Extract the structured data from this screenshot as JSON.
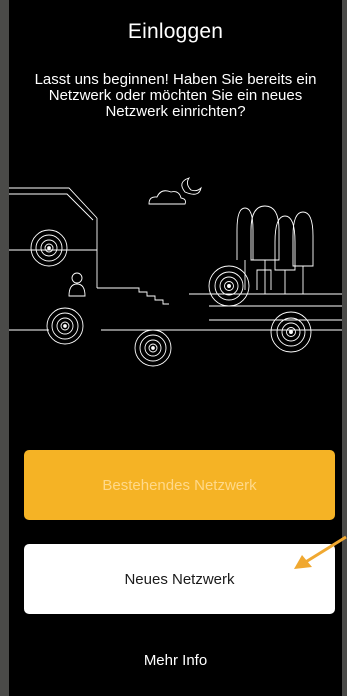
{
  "header": {
    "title": "Einloggen",
    "subtitle": "Lasst uns beginnen! Haben Sie bereits ein Netzwerk oder möchten Sie ein neues Netzwerk einrichten?"
  },
  "illustration": {
    "icon": "home-network-illustration"
  },
  "actions": {
    "existing_network_label": "Bestehendes Netzwerk",
    "new_network_label": "Neues Netzwerk",
    "more_info_label": "Mehr Info"
  },
  "colors": {
    "background": "#000000",
    "primary_button": "#f5b325",
    "secondary_button": "#ffffff",
    "annotation_arrow": "#f0a830"
  }
}
